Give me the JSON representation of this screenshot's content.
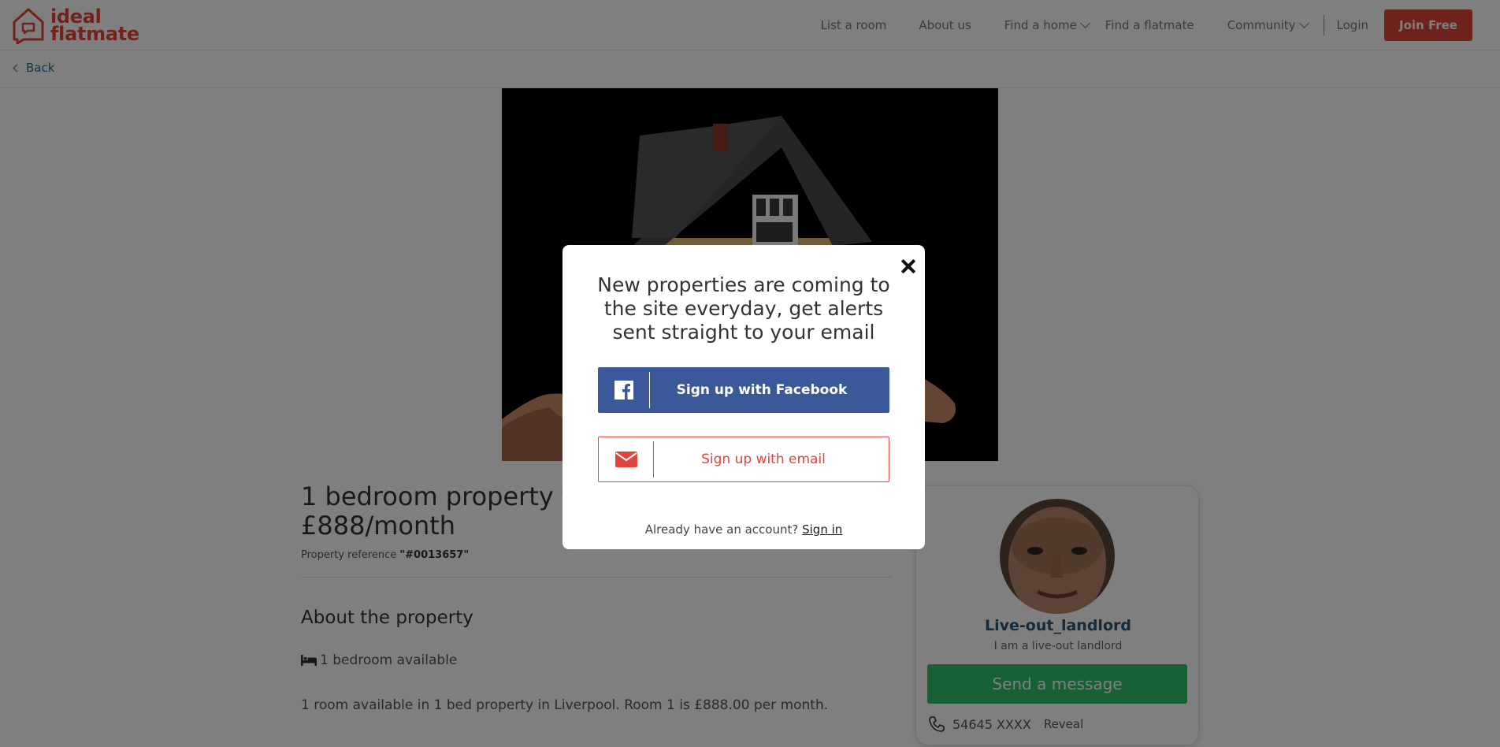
{
  "brand": {
    "line1": "ideal",
    "line2": "flatmate",
    "accent": "#e0453a"
  },
  "nav": {
    "list_room": "List a room",
    "about_us": "About us",
    "find_home": "Find a home",
    "find_flatmate": "Find a flatmate",
    "community": "Community",
    "login": "Login",
    "join": "Join Free"
  },
  "back": "Back",
  "listing": {
    "title_line1": "1 bedroom property fo",
    "title_line2": "£888/month",
    "ref_prefix": "Property reference ",
    "ref_value": "\"#0013657\"",
    "about_heading": "About the property",
    "bedrooms": "1 bedroom available",
    "description": "1 room available in 1 bed property in Liverpool. Room 1 is £888.00 per month."
  },
  "profile": {
    "username": "Live-out_landlord",
    "type": "I am a live-out landlord",
    "message_button": "Send a message",
    "phone": "54645 XXXX",
    "reveal": "Reveal",
    "button_color": "#2ec26b"
  },
  "modal": {
    "title": "New properties are coming to the site everyday, get alerts sent straight to your email",
    "facebook_button": "Sign up with Facebook",
    "email_button": "Sign up with email",
    "signin_prompt": "Already have an account? ",
    "signin_link": "Sign in",
    "facebook_color": "#3b5998"
  }
}
